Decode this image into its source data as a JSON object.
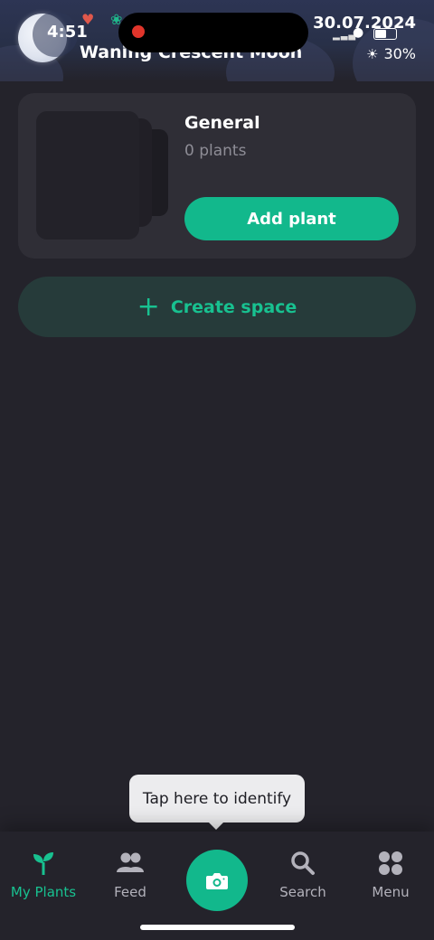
{
  "status_bar": {
    "time": "4:51",
    "date": "30.07.2024",
    "moon_phase": "Waning Crescent Moon",
    "weather": "30%"
  },
  "space_card": {
    "name": "General",
    "count": "0 plants",
    "add_button": "Add plant"
  },
  "create_space": {
    "label": "Create space"
  },
  "tooltip": {
    "text": "Tap here to identify"
  },
  "tabs": [
    {
      "label": "My Plants",
      "icon": "sprout-icon",
      "active": true
    },
    {
      "label": "Feed",
      "icon": "people-icon",
      "active": false
    },
    {
      "label": "",
      "icon": "camera-icon",
      "active": false
    },
    {
      "label": "Search",
      "icon": "search-icon",
      "active": false
    },
    {
      "label": "Menu",
      "icon": "grid-icon",
      "active": false
    }
  ],
  "colors": {
    "accent": "#12b88c",
    "background": "#24232b",
    "card": "#2f2e36"
  }
}
